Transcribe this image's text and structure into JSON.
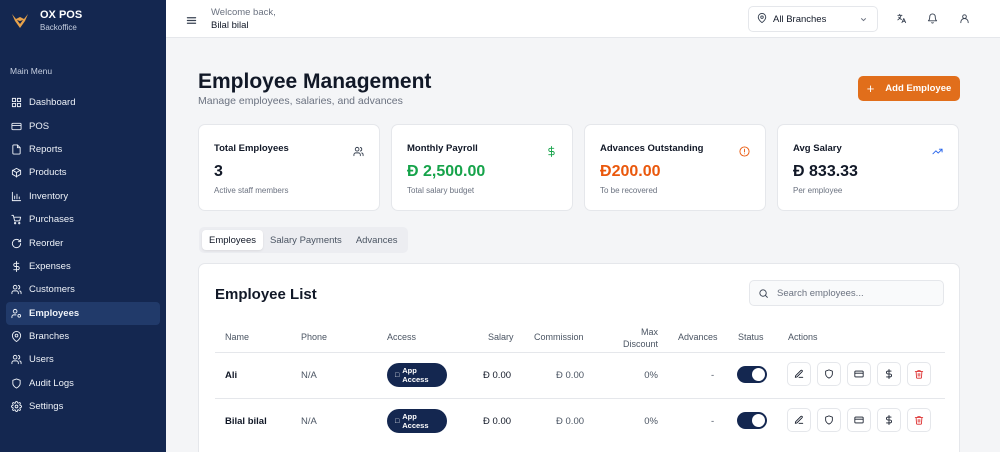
{
  "brand": {
    "name": "OX POS",
    "sub": "Backoffice"
  },
  "sidebar": {
    "section_label": "Main Menu",
    "items": [
      {
        "label": "Dashboard",
        "icon": "dashboard-icon"
      },
      {
        "label": "POS",
        "icon": "card-icon"
      },
      {
        "label": "Reports",
        "icon": "document-icon"
      },
      {
        "label": "Products",
        "icon": "box-icon"
      },
      {
        "label": "Inventory",
        "icon": "bar-chart-icon"
      },
      {
        "label": "Purchases",
        "icon": "cart-icon"
      },
      {
        "label": "Reorder",
        "icon": "refresh-icon"
      },
      {
        "label": "Expenses",
        "icon": "dollar-icon"
      },
      {
        "label": "Customers",
        "icon": "users-icon"
      },
      {
        "label": "Employees",
        "icon": "user-cog-icon",
        "active": true
      },
      {
        "label": "Branches",
        "icon": "map-pin-icon"
      },
      {
        "label": "Users",
        "icon": "users-icon"
      },
      {
        "label": "Audit Logs",
        "icon": "shield-icon"
      },
      {
        "label": "Settings",
        "icon": "gear-icon"
      }
    ]
  },
  "topbar": {
    "welcome": "Welcome back,",
    "user": "Bilal bilal",
    "branch": "All Branches"
  },
  "header": {
    "title": "Employee Management",
    "subtitle": "Manage employees, salaries, and advances",
    "add_button": "Add Employee"
  },
  "stats": [
    {
      "title": "Total Employees",
      "value": "3",
      "sub": "Active staff members",
      "icon": "users-icon",
      "color": "#111827"
    },
    {
      "title": "Monthly Payroll",
      "value": "2,500.00",
      "sub": "Total salary budget",
      "icon": "dollar-icon",
      "color": "#16a34a",
      "currency": true
    },
    {
      "title": "Advances Outstanding",
      "value": "200.00",
      "sub": "To be recovered",
      "icon": "alert-circle-icon",
      "color": "#ea580c",
      "currency": true
    },
    {
      "title": "Avg Salary",
      "value": "833.33",
      "sub": "Per employee",
      "icon": "trending-up-icon",
      "color": "#111827",
      "currency": true
    }
  ],
  "currency_symbol": "Đ",
  "tabs": [
    "Employees",
    "Salary Payments",
    "Advances"
  ],
  "list": {
    "title": "Employee List",
    "search_placeholder": "Search employees...",
    "columns": [
      "Name",
      "Phone",
      "Access",
      "Salary",
      "Commission",
      "Max Discount",
      "Advances",
      "Status",
      "Actions"
    ],
    "rows": [
      {
        "name": "Ali",
        "phone": "N/A",
        "access": "App Access",
        "salary": "0.00",
        "commission": "0.00",
        "max_discount": "0%",
        "advances": "-",
        "status": "active"
      },
      {
        "name": "Bilal bilal",
        "phone": "N/A",
        "access": "App Access",
        "salary": "0.00",
        "commission": "0.00",
        "max_discount": "0%",
        "advances": "-",
        "status": "active"
      }
    ]
  },
  "colors": {
    "sidebar": "#142750",
    "accent": "#e16e1b"
  }
}
